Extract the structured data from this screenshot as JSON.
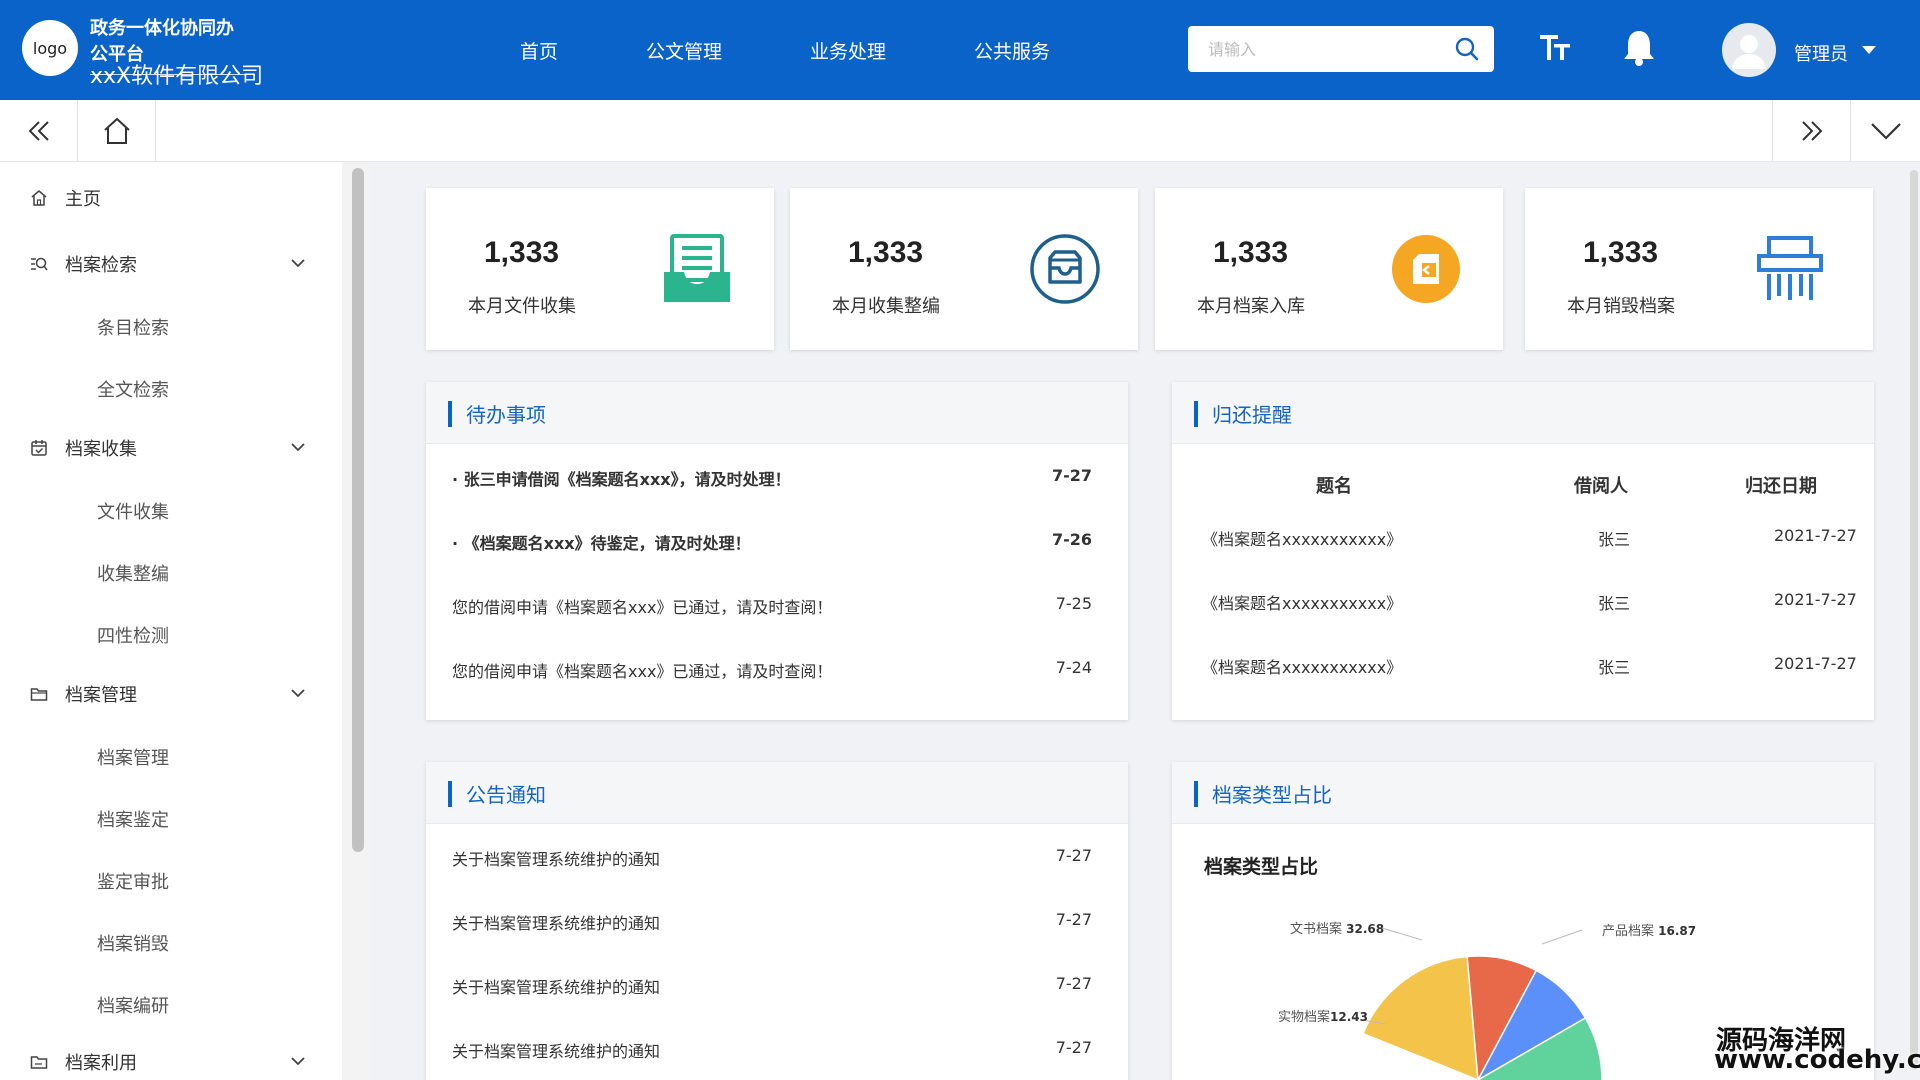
{
  "header": {
    "logo_text": "logo",
    "brand_title": "政务一体化协同办公平台",
    "brand_sub": "xxX软件有限公司",
    "nav": [
      "首页",
      "公文管理",
      "业务处理",
      "公共服务"
    ],
    "search_placeholder": "请输入",
    "user_name": "管理员",
    "accent_color": "#0a63c8"
  },
  "sidebar": {
    "home": "主页",
    "groups": [
      {
        "label": "档案检索",
        "icon": "search-list-icon",
        "items": [
          "条目检索",
          "全文检索"
        ]
      },
      {
        "label": "档案收集",
        "icon": "calendar-check-icon",
        "items": [
          "文件收集",
          "收集整编",
          "四性检测"
        ]
      },
      {
        "label": "档案管理",
        "icon": "folder-icon",
        "items": [
          "档案管理",
          "档案鉴定",
          "鉴定审批",
          "档案销毁",
          "档案编研"
        ]
      },
      {
        "label": "档案利用",
        "icon": "folder-share-icon",
        "items": []
      }
    ]
  },
  "stats": [
    {
      "value": "1,333",
      "label": "本月文件收集",
      "icon": "inbox-document-icon",
      "color": "#2bb58f"
    },
    {
      "value": "1,333",
      "label": "本月收集整编",
      "icon": "tray-icon",
      "color": "#1f5f8b"
    },
    {
      "value": "1,333",
      "label": "本月档案入库",
      "icon": "archive-in-icon",
      "color": "#f5a623"
    },
    {
      "value": "1,333",
      "label": "本月销毁档案",
      "icon": "shredder-icon",
      "color": "#2d7ed8"
    }
  ],
  "todo": {
    "title": "待办事项",
    "rows": [
      {
        "text": "· 张三申请借阅《档案题名xxx》，请及时处理！",
        "date": "7-27",
        "bold": true
      },
      {
        "text": "· 《档案题名xxx》待鉴定，请及时处理！",
        "date": "7-26",
        "bold": true
      },
      {
        "text": "您的借阅申请《档案题名xxx》已通过，请及时查阅！",
        "date": "7-25",
        "bold": false
      },
      {
        "text": "您的借阅申请《档案题名xxx》已通过，请及时查阅！",
        "date": "7-24",
        "bold": false
      }
    ]
  },
  "return_reminder": {
    "title": "归还提醒",
    "columns": [
      "题名",
      "借阅人",
      "归还日期"
    ],
    "rows": [
      [
        "《档案题名xxxxxxxxxxx》",
        "张三",
        "2021-7-27"
      ],
      [
        "《档案题名xxxxxxxxxxx》",
        "张三",
        "2021-7-27"
      ],
      [
        "《档案题名xxxxxxxxxxx》",
        "张三",
        "2021-7-27"
      ]
    ]
  },
  "notices": {
    "title": "公告通知",
    "rows": [
      {
        "text": "关于档案管理系统维护的通知",
        "date": "7-27"
      },
      {
        "text": "关于档案管理系统维护的通知",
        "date": "7-27"
      },
      {
        "text": "关于档案管理系统维护的通知",
        "date": "7-27"
      },
      {
        "text": "关于档案管理系统维护的通知",
        "date": "7-27"
      }
    ]
  },
  "archive_types": {
    "panel_title": "档案类型占比",
    "chart_title": "档案类型占比"
  },
  "chart_data": {
    "type": "pie",
    "title": "档案类型占比",
    "slices": [
      {
        "label": "文书档案",
        "value": 32.68,
        "color": "#5fd39b"
      },
      {
        "label": "产品档案",
        "value": 16.87,
        "color": "#5b8ff9"
      },
      {
        "label": "实物档案",
        "value": 12.43,
        "color": "#f4c44a"
      },
      {
        "label": "",
        "value": null,
        "color": "#e8684a"
      }
    ]
  },
  "watermark": [
    "源码海洋网",
    "www.codehy.com"
  ]
}
